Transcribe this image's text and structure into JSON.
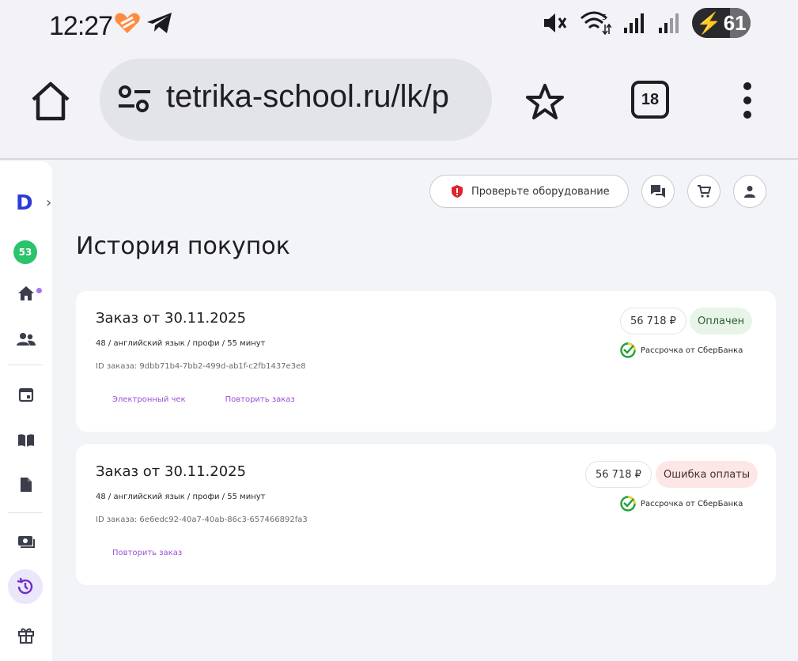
{
  "status_bar": {
    "time": "12:27",
    "battery": "61",
    "icons": [
      "heart-orange-icon",
      "telegram-icon",
      "mute-icon",
      "wifi-icon",
      "signal-icon",
      "signal-icon",
      "bolt-icon"
    ]
  },
  "browser": {
    "url": "tetrika-school.ru/lk/p",
    "tabs_count": "18"
  },
  "sidebar": {
    "logo": "D",
    "badge": "53"
  },
  "header": {
    "check_equipment": "Проверьте оборудование"
  },
  "page": {
    "title": "История покупок"
  },
  "orders": [
    {
      "title": "Заказ от 30.11.2025",
      "description": "48 / английский язык / профи / 55 минут",
      "id": "ID заказа: 9dbb71b4-7bb2-499d-ab1f-c2fb1437e3e8",
      "price": "56 718 ₽",
      "status": "Оплачен",
      "installment": "Рассрочка от СберБанка",
      "link_receipt": "Электронный чек",
      "link_repeat": "Повторить заказ"
    },
    {
      "title": "Заказ от 30.11.2025",
      "description": "48 / английский язык / профи / 55 минут",
      "id": "ID заказа: 6e6edc92-40a7-40ab-86c3-657466892fa3",
      "price": "56 718 ₽",
      "status": "Ошибка оплаты",
      "installment": "Рассрочка от СберБанка",
      "link_repeat": "Повторить заказ"
    }
  ],
  "colors": {
    "accent": "#9b4fd4",
    "paid_bg": "#e9f4e9",
    "error_bg": "#fde6e6",
    "logo": "#2b3bd9",
    "badge": "#2bc36b"
  }
}
